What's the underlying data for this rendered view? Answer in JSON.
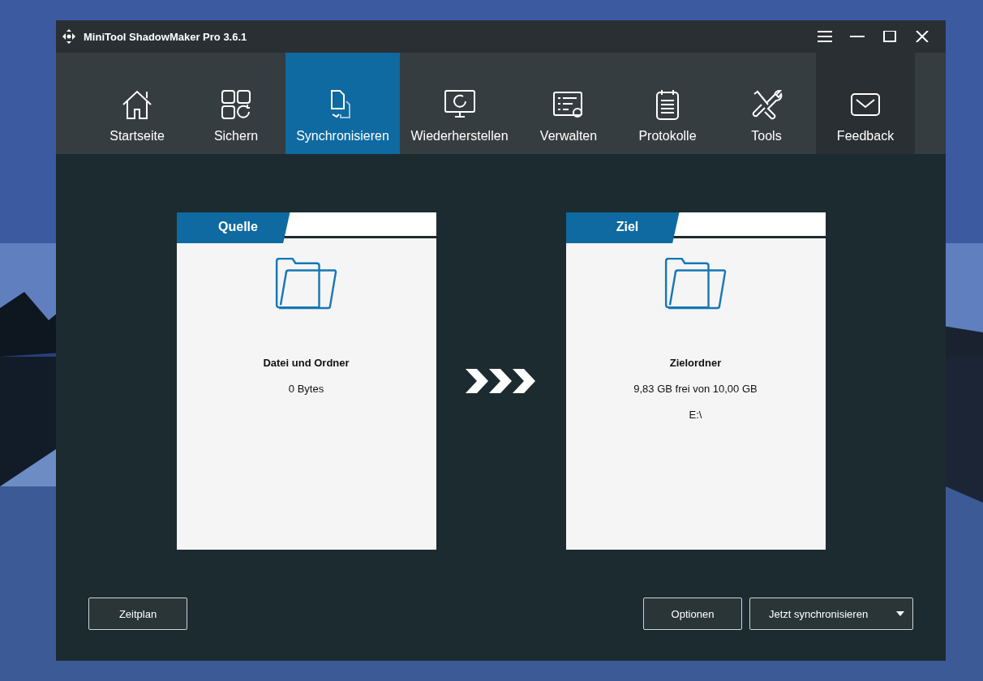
{
  "window": {
    "title": "MiniTool ShadowMaker Pro 3.6.1"
  },
  "tabs": [
    {
      "label": "Startseite",
      "selected": false,
      "kind": "module"
    },
    {
      "label": "Sichern",
      "selected": false,
      "kind": "module"
    },
    {
      "label": "Synchronisieren",
      "selected": true,
      "kind": "module"
    },
    {
      "label": "Wiederherstellen",
      "selected": false,
      "kind": "module"
    },
    {
      "label": "Verwalten",
      "selected": false,
      "kind": "module"
    },
    {
      "label": "Protokolle",
      "selected": false,
      "kind": "module"
    },
    {
      "label": "Tools",
      "selected": false,
      "kind": "module"
    },
    {
      "label": "Feedback",
      "selected": false,
      "kind": "feedback"
    }
  ],
  "cards": [
    {
      "label": "Quelle",
      "title": "Datei und Ordner",
      "lines": [
        "0 Bytes"
      ]
    },
    {
      "label": "Ziel",
      "title": "Zielordner",
      "lines": [
        "9,83 GB frei von 10,00 GB",
        "E:\\"
      ]
    }
  ],
  "buttons": {
    "left": [
      "Zeitplan"
    ],
    "right": [
      "Optionen"
    ],
    "main": "Jetzt synchronisieren"
  }
}
